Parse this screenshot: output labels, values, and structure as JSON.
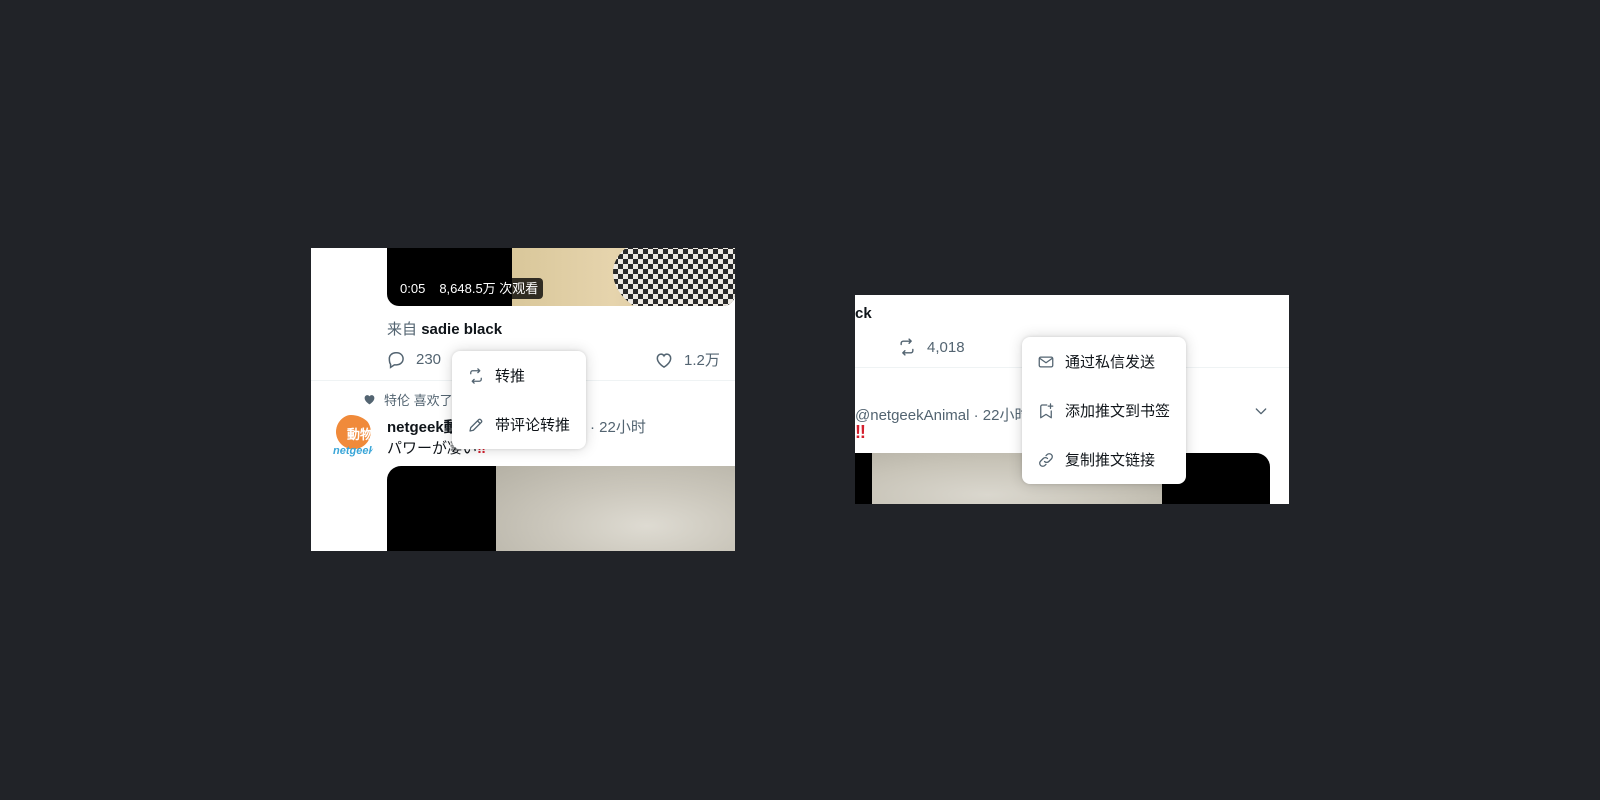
{
  "left": {
    "video": {
      "duration": "0:05",
      "views": "8,648.5万 次观看"
    },
    "from_prefix": "来自",
    "from_user": "sadie black",
    "reply_count": "230",
    "like_count": "1.2万",
    "social_context": "特伦 喜欢了",
    "tweet": {
      "name": "netgeek動物",
      "time": "· 22小时",
      "text": "パワーが凄い",
      "emoji": "‼"
    },
    "avatar_text": {
      "top": "動物",
      "bottom": "netgeek"
    },
    "menu": [
      {
        "icon": "retweet-icon",
        "label": "转推"
      },
      {
        "icon": "pencil-icon",
        "label": "带评论转推"
      }
    ]
  },
  "right": {
    "name_fragment": "ck",
    "retweet_count": "4,018",
    "handle_time": "@netgeekAnimal · 22小时",
    "emoji": "‼",
    "menu": [
      {
        "icon": "envelope-icon",
        "label": "通过私信发送"
      },
      {
        "icon": "bookmark-add-icon",
        "label": "添加推文到书签"
      },
      {
        "icon": "link-icon",
        "label": "复制推文链接"
      }
    ]
  },
  "colors": {
    "background": "#212328",
    "text_primary": "#0f1419",
    "text_secondary": "#536471",
    "emoji_red": "#d4202e"
  }
}
